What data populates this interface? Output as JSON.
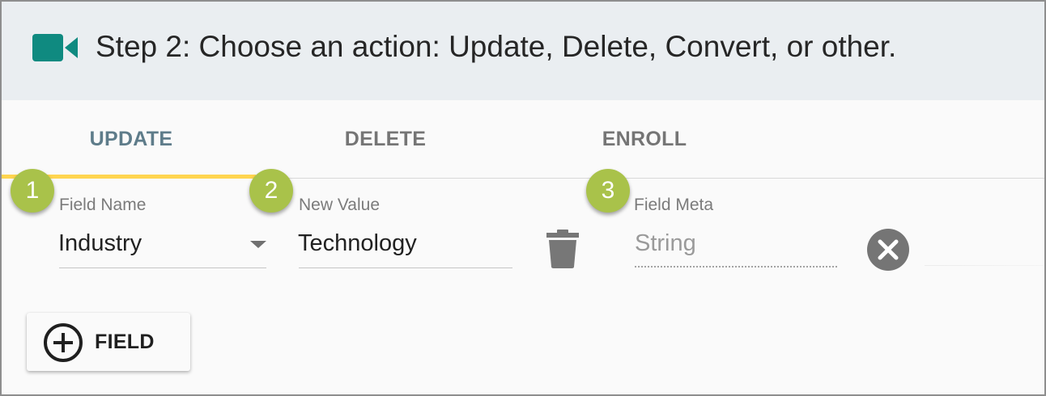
{
  "header": {
    "title": "Step 2: Choose an action: Update, Delete, Convert, or other.",
    "icon": "video-camera-icon",
    "icon_color": "#0f8a80"
  },
  "tabs": [
    {
      "label": "UPDATE",
      "active": true
    },
    {
      "label": "DELETE",
      "active": false
    },
    {
      "label": "ENROLL",
      "active": false
    }
  ],
  "badges": [
    "1",
    "2",
    "3"
  ],
  "badge_color": "#a9c24a",
  "accent_color": "#ffd54f",
  "fields": {
    "field_name": {
      "label": "Field Name",
      "value": "Industry"
    },
    "new_value": {
      "label": "New Value",
      "value": "Technology"
    },
    "field_meta": {
      "label": "Field Meta",
      "placeholder": "String"
    }
  },
  "icons": {
    "delete": "trash-icon",
    "clear": "close-circle-icon",
    "add": "add-circle-icon",
    "dropdown": "dropdown-arrow-icon"
  },
  "add_button": {
    "label": "FIELD"
  }
}
